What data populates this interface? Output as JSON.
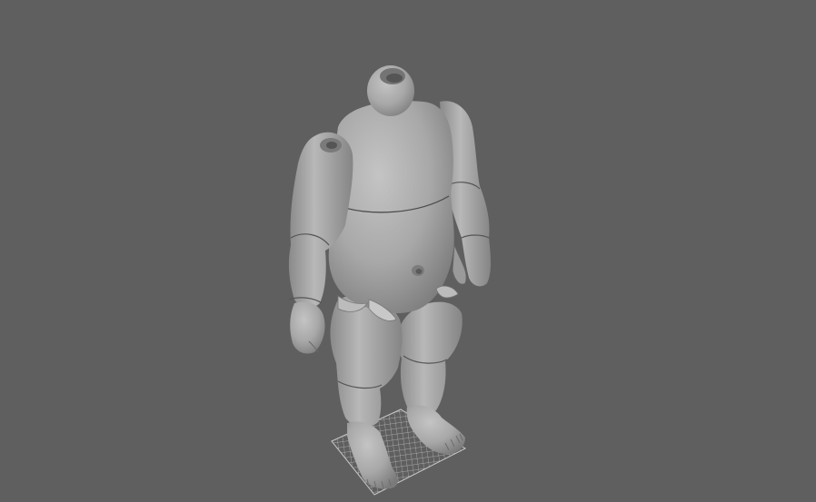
{
  "viewport": {
    "background_color": "#5f5f5f",
    "model": {
      "description_icon": "doll-body-mesh-icon",
      "shading_color": "#a9a9a9",
      "highlight_color": "#c6c6c6",
      "shadow_color": "#777777",
      "seam_color": "#3f3f3f"
    },
    "ground_grid": {
      "icon": "grid-icon",
      "color": "#d8d8d8"
    }
  }
}
